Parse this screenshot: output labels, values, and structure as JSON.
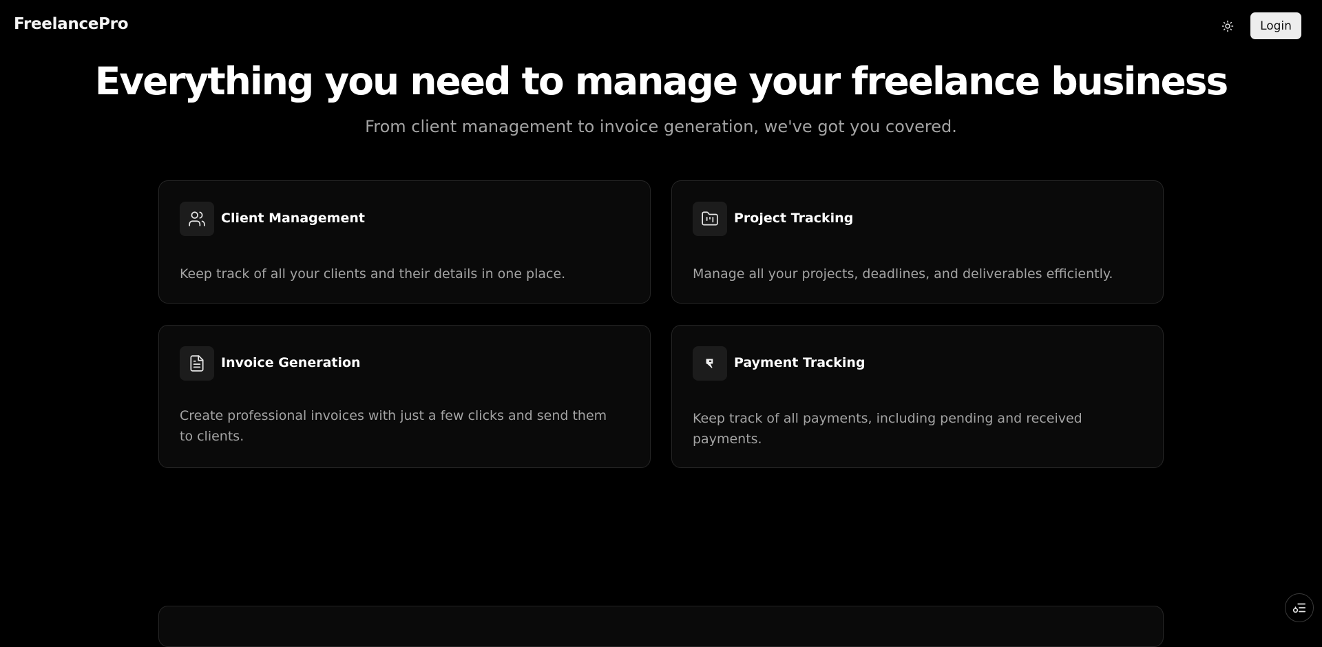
{
  "navbar": {
    "brand": "FreelancePro",
    "theme_toggle_icon": "sun-icon",
    "login_label": "Login"
  },
  "hero": {
    "title": "Everything you need to manage your freelance business",
    "subtitle": "From client management to invoice generation, we've got you covered."
  },
  "features": [
    {
      "icon": "users-icon",
      "title": "Client Management",
      "description": "Keep track of all your clients and their details in one place."
    },
    {
      "icon": "folder-chart-icon",
      "title": "Project Tracking",
      "description": "Manage all your projects, deadlines, and deliverables efficiently."
    },
    {
      "icon": "file-text-icon",
      "title": "Invoice Generation",
      "description": "Create professional invoices with just a few clicks and send them to clients."
    },
    {
      "icon": "payment-icon",
      "title": "Payment Tracking",
      "description": "Keep track of all payments, including pending and received payments."
    }
  ],
  "floating_button_icon": "settings-list-icon",
  "colors": {
    "background": "#000000",
    "card_background": "#0a0a0a",
    "card_border": "#262626",
    "muted_text": "#a3a3a3",
    "button_bg": "#ededed"
  }
}
